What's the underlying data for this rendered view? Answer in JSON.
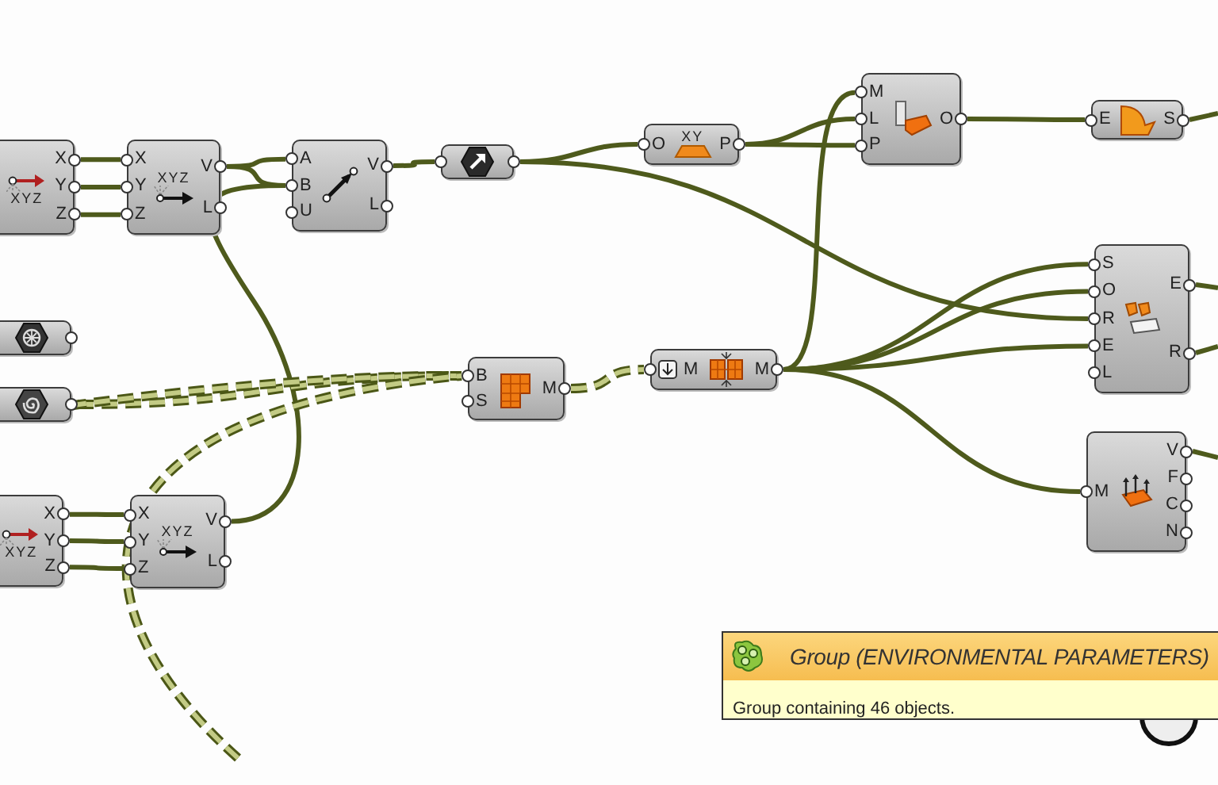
{
  "canvas": {
    "nodes": [
      {
        "kind": "component",
        "outputs": [
          "X",
          "Y",
          "Z"
        ],
        "icon_label": "XYZ"
      },
      {
        "kind": "component",
        "inputs": [
          "X",
          "Y",
          "Z"
        ],
        "outputs": [
          "V",
          "L"
        ],
        "icon_label": "XYZ",
        "flatten": false
      },
      {
        "kind": "component",
        "inputs": [
          "A",
          "B",
          "U"
        ],
        "outputs": [
          "V",
          "L"
        ],
        "flatten": false
      },
      {
        "kind": "param"
      },
      {
        "kind": "component",
        "inputs": [
          "O"
        ],
        "outputs": [
          "P"
        ],
        "icon_label": "XY",
        "flatten": false
      },
      {
        "kind": "component",
        "inputs": [
          "M",
          "L",
          "P"
        ],
        "outputs": [
          "O"
        ],
        "flatten": false
      },
      {
        "kind": "component",
        "inputs": [
          "E"
        ],
        "outputs": [
          "S"
        ],
        "flatten": false
      },
      {
        "kind": "param"
      },
      {
        "kind": "param"
      },
      {
        "kind": "component",
        "inputs": [
          "B",
          "S"
        ],
        "outputs": [
          "M"
        ],
        "flatten": false
      },
      {
        "kind": "component",
        "inputs": [
          "M"
        ],
        "outputs": [
          "M"
        ],
        "flatten": true
      },
      {
        "kind": "component",
        "inputs": [
          "S",
          "O",
          "R",
          "E",
          "L"
        ],
        "outputs": [
          "E",
          "R"
        ],
        "flatten": false
      },
      {
        "kind": "component",
        "inputs": [
          "M"
        ],
        "outputs": [
          "V",
          "F",
          "C",
          "N"
        ],
        "flatten": false
      },
      {
        "kind": "component",
        "outputs": [
          "X",
          "Y",
          "Z"
        ],
        "icon_label": "XYZ"
      },
      {
        "kind": "component",
        "inputs": [
          "X",
          "Y",
          "Z"
        ],
        "outputs": [
          "V",
          "L"
        ],
        "icon_label": "XYZ",
        "flatten": false
      }
    ]
  },
  "tooltip": {
    "title": "Group (ENVIRONMENTAL PARAMETERS)",
    "description": "Group containing 46 objects."
  }
}
